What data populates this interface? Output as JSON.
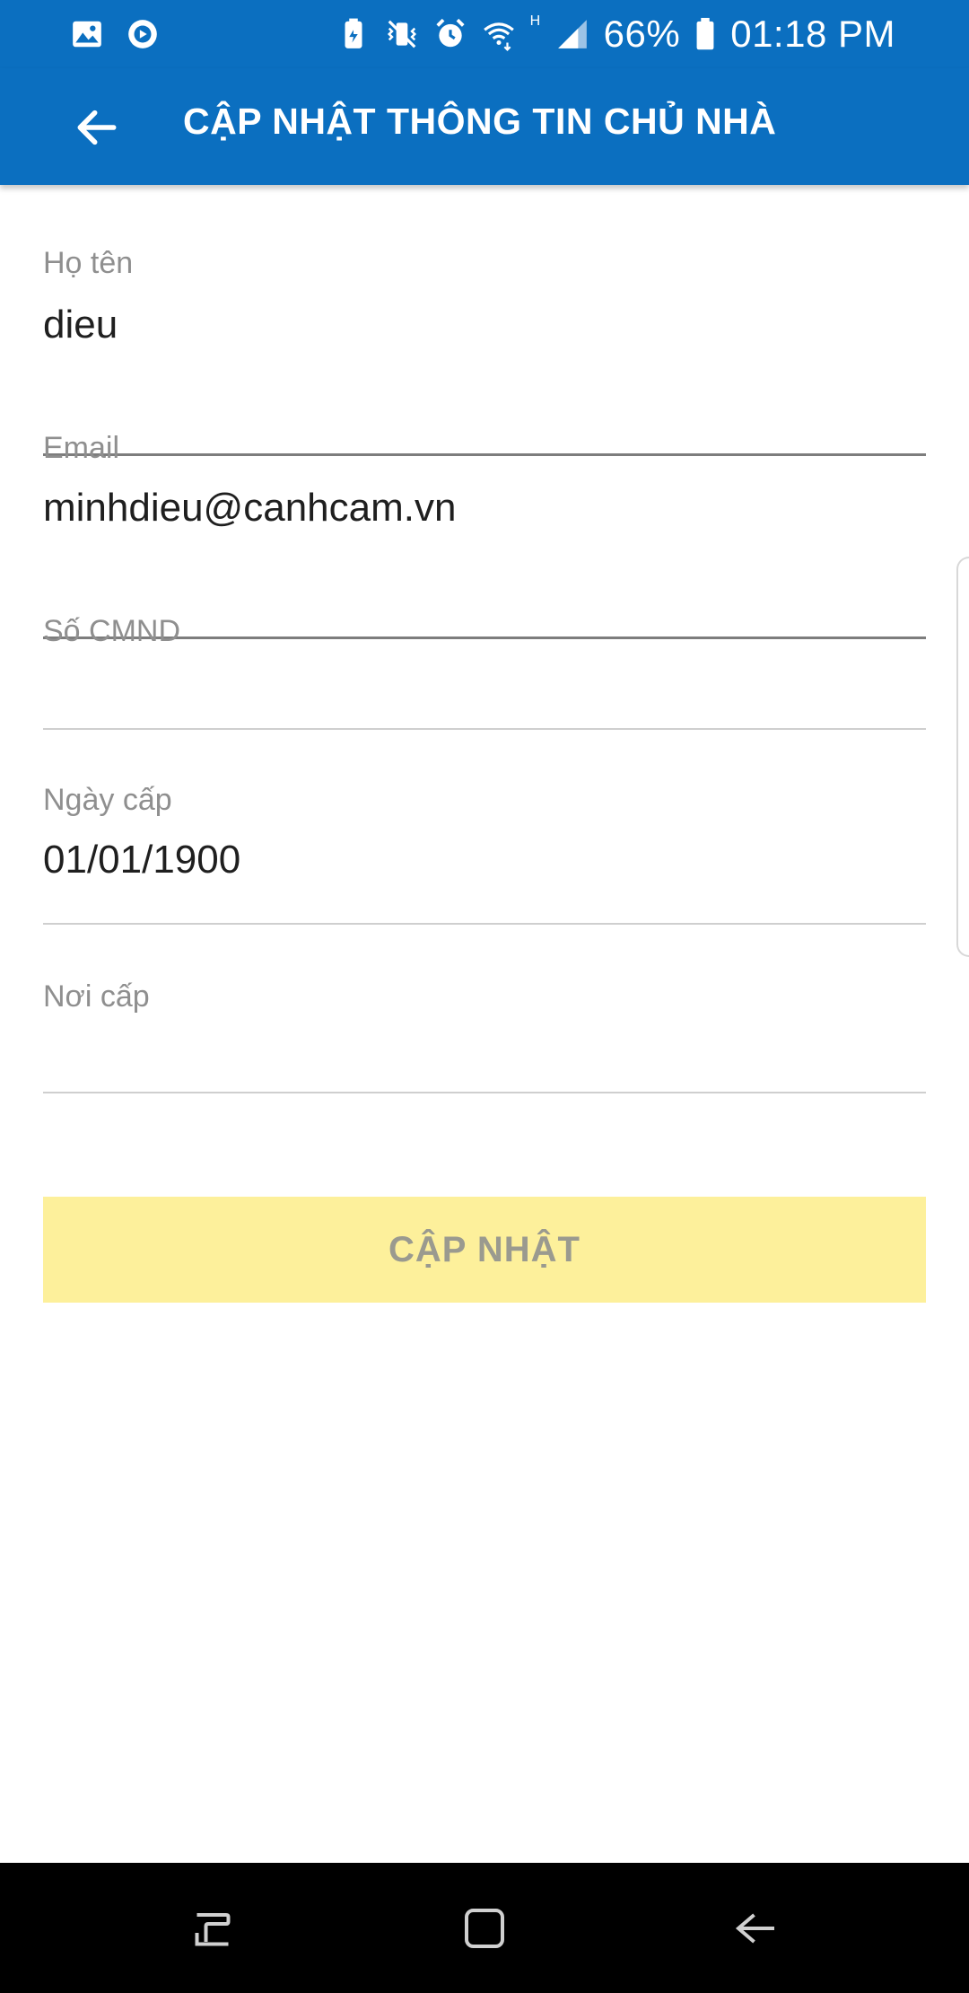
{
  "status_bar": {
    "battery": "66%",
    "time": "01:18 PM",
    "network_type": "H",
    "icons": [
      "gallery-icon",
      "screen-recorder-icon",
      "battery-saver-icon",
      "vibrate-icon",
      "alarm-icon",
      "wifi-icon",
      "signal-icon",
      "battery-icon"
    ]
  },
  "app_bar": {
    "title": "CẬP NHẬT THÔNG TIN CHỦ NHÀ",
    "back_icon": "arrow-left-icon"
  },
  "form": {
    "full_name": {
      "label": "Họ tên",
      "value": "dieu"
    },
    "email": {
      "label": "Email",
      "value": "minhdieu@canhcam.vn"
    },
    "id_number": {
      "label": "Số CMND",
      "value": ""
    },
    "issue_date": {
      "label": "Ngày cấp",
      "value": "01/01/1900"
    },
    "issue_place": {
      "label": "Nơi cấp",
      "value": ""
    },
    "submit_label": "CẬP NHẬT"
  },
  "colors": {
    "primary": "#0b6fc0",
    "button_bg": "#fdf09b",
    "button_text": "#9a9a8f",
    "label": "#8f8f8f"
  },
  "nav_bar": {
    "icons": [
      "recent-apps-icon",
      "home-icon",
      "back-icon"
    ]
  }
}
